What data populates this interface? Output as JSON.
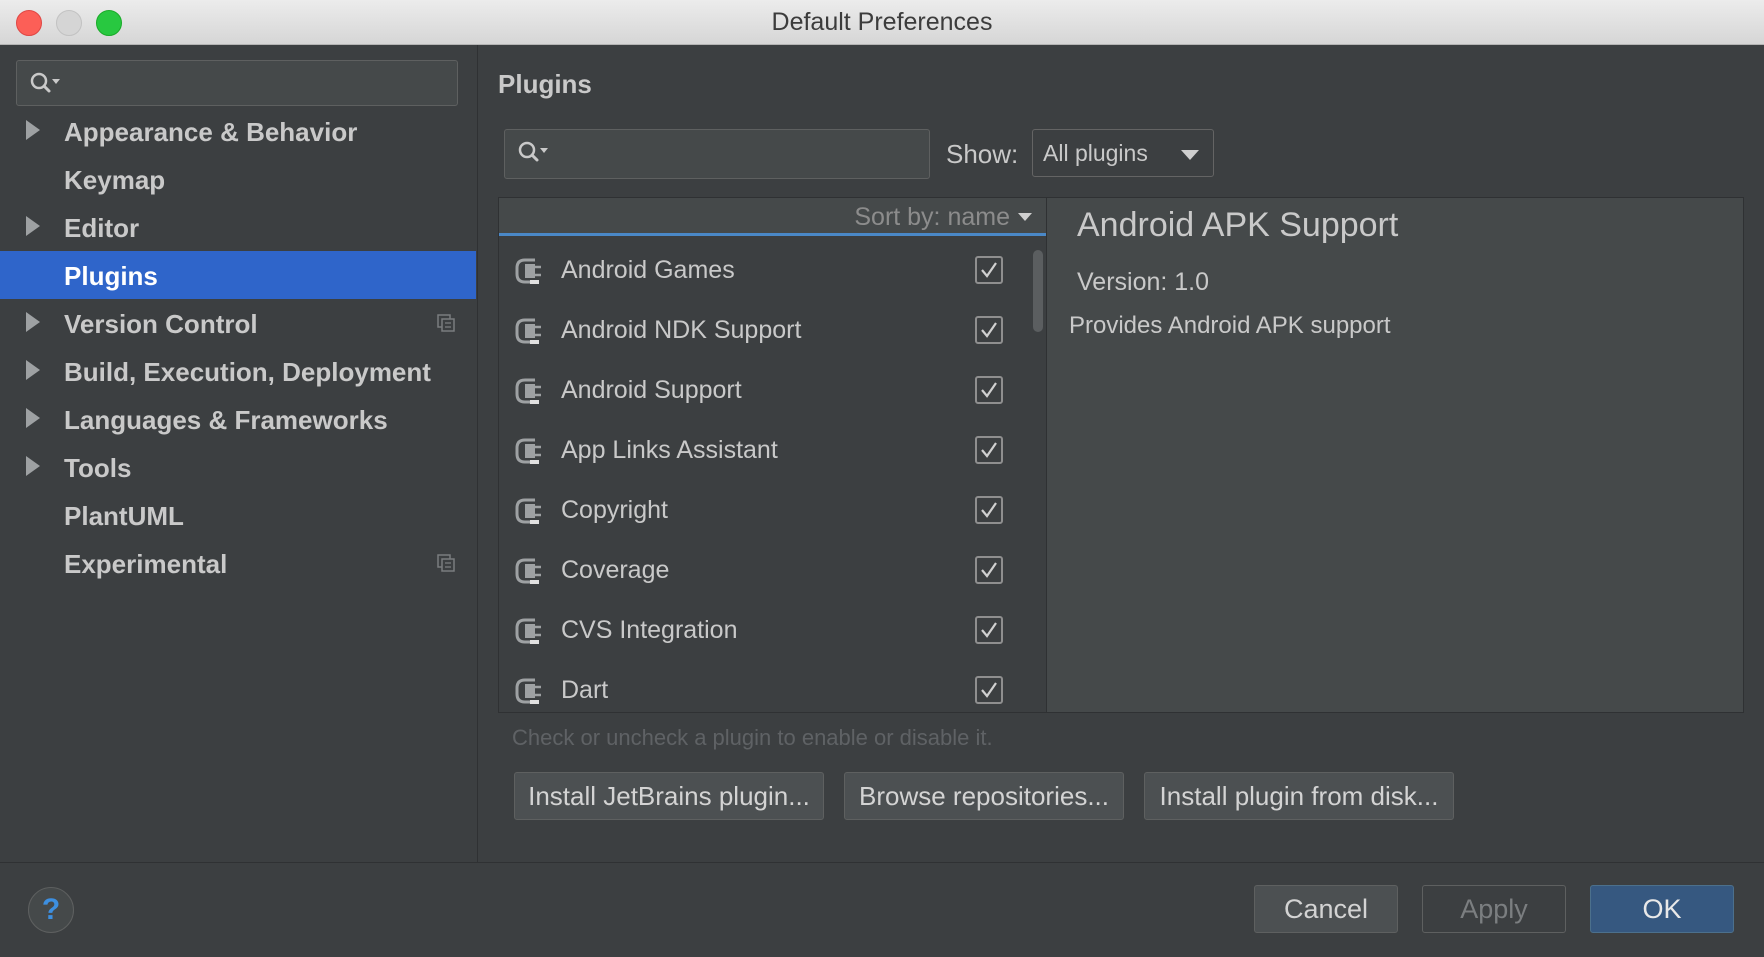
{
  "window": {
    "title": "Default Preferences"
  },
  "sidebar": {
    "search": {
      "placeholder": ""
    },
    "items": [
      {
        "label": "Appearance & Behavior",
        "expandable": true,
        "badge": false,
        "selected": false
      },
      {
        "label": "Keymap",
        "expandable": false,
        "badge": false,
        "selected": false
      },
      {
        "label": "Editor",
        "expandable": true,
        "badge": false,
        "selected": false
      },
      {
        "label": "Plugins",
        "expandable": false,
        "badge": false,
        "selected": true
      },
      {
        "label": "Version Control",
        "expandable": true,
        "badge": true,
        "selected": false
      },
      {
        "label": "Build, Execution, Deployment",
        "expandable": true,
        "badge": false,
        "selected": false
      },
      {
        "label": "Languages & Frameworks",
        "expandable": true,
        "badge": false,
        "selected": false
      },
      {
        "label": "Tools",
        "expandable": true,
        "badge": false,
        "selected": false
      },
      {
        "label": "PlantUML",
        "expandable": false,
        "badge": false,
        "selected": false
      },
      {
        "label": "Experimental",
        "expandable": false,
        "badge": true,
        "selected": false
      }
    ]
  },
  "main": {
    "title": "Plugins",
    "search": {
      "placeholder": ""
    },
    "show_label": "Show:",
    "show_value": "All plugins",
    "sort_label": "Sort by: name",
    "plugins": [
      {
        "name": "Android Games",
        "enabled": true
      },
      {
        "name": "Android NDK Support",
        "enabled": true
      },
      {
        "name": "Android Support",
        "enabled": true
      },
      {
        "name": "App Links Assistant",
        "enabled": true
      },
      {
        "name": "Copyright",
        "enabled": true
      },
      {
        "name": "Coverage",
        "enabled": true
      },
      {
        "name": "CVS Integration",
        "enabled": true
      },
      {
        "name": "Dart",
        "enabled": true
      }
    ],
    "detail": {
      "title": "Android APK Support",
      "version": "Version: 1.0",
      "description": "Provides Android APK support"
    },
    "hint": "Check or uncheck a plugin to enable or disable it.",
    "buttons": {
      "install_jetbrains": "Install JetBrains plugin...",
      "browse": "Browse repositories...",
      "install_disk": "Install plugin from disk..."
    }
  },
  "footer": {
    "help": "?",
    "cancel": "Cancel",
    "apply": "Apply",
    "ok": "OK"
  },
  "colors": {
    "background": "#3c3f41",
    "selection": "#2f65ca",
    "primary_button": "#365880",
    "help_icon": "#3d8fe0"
  }
}
